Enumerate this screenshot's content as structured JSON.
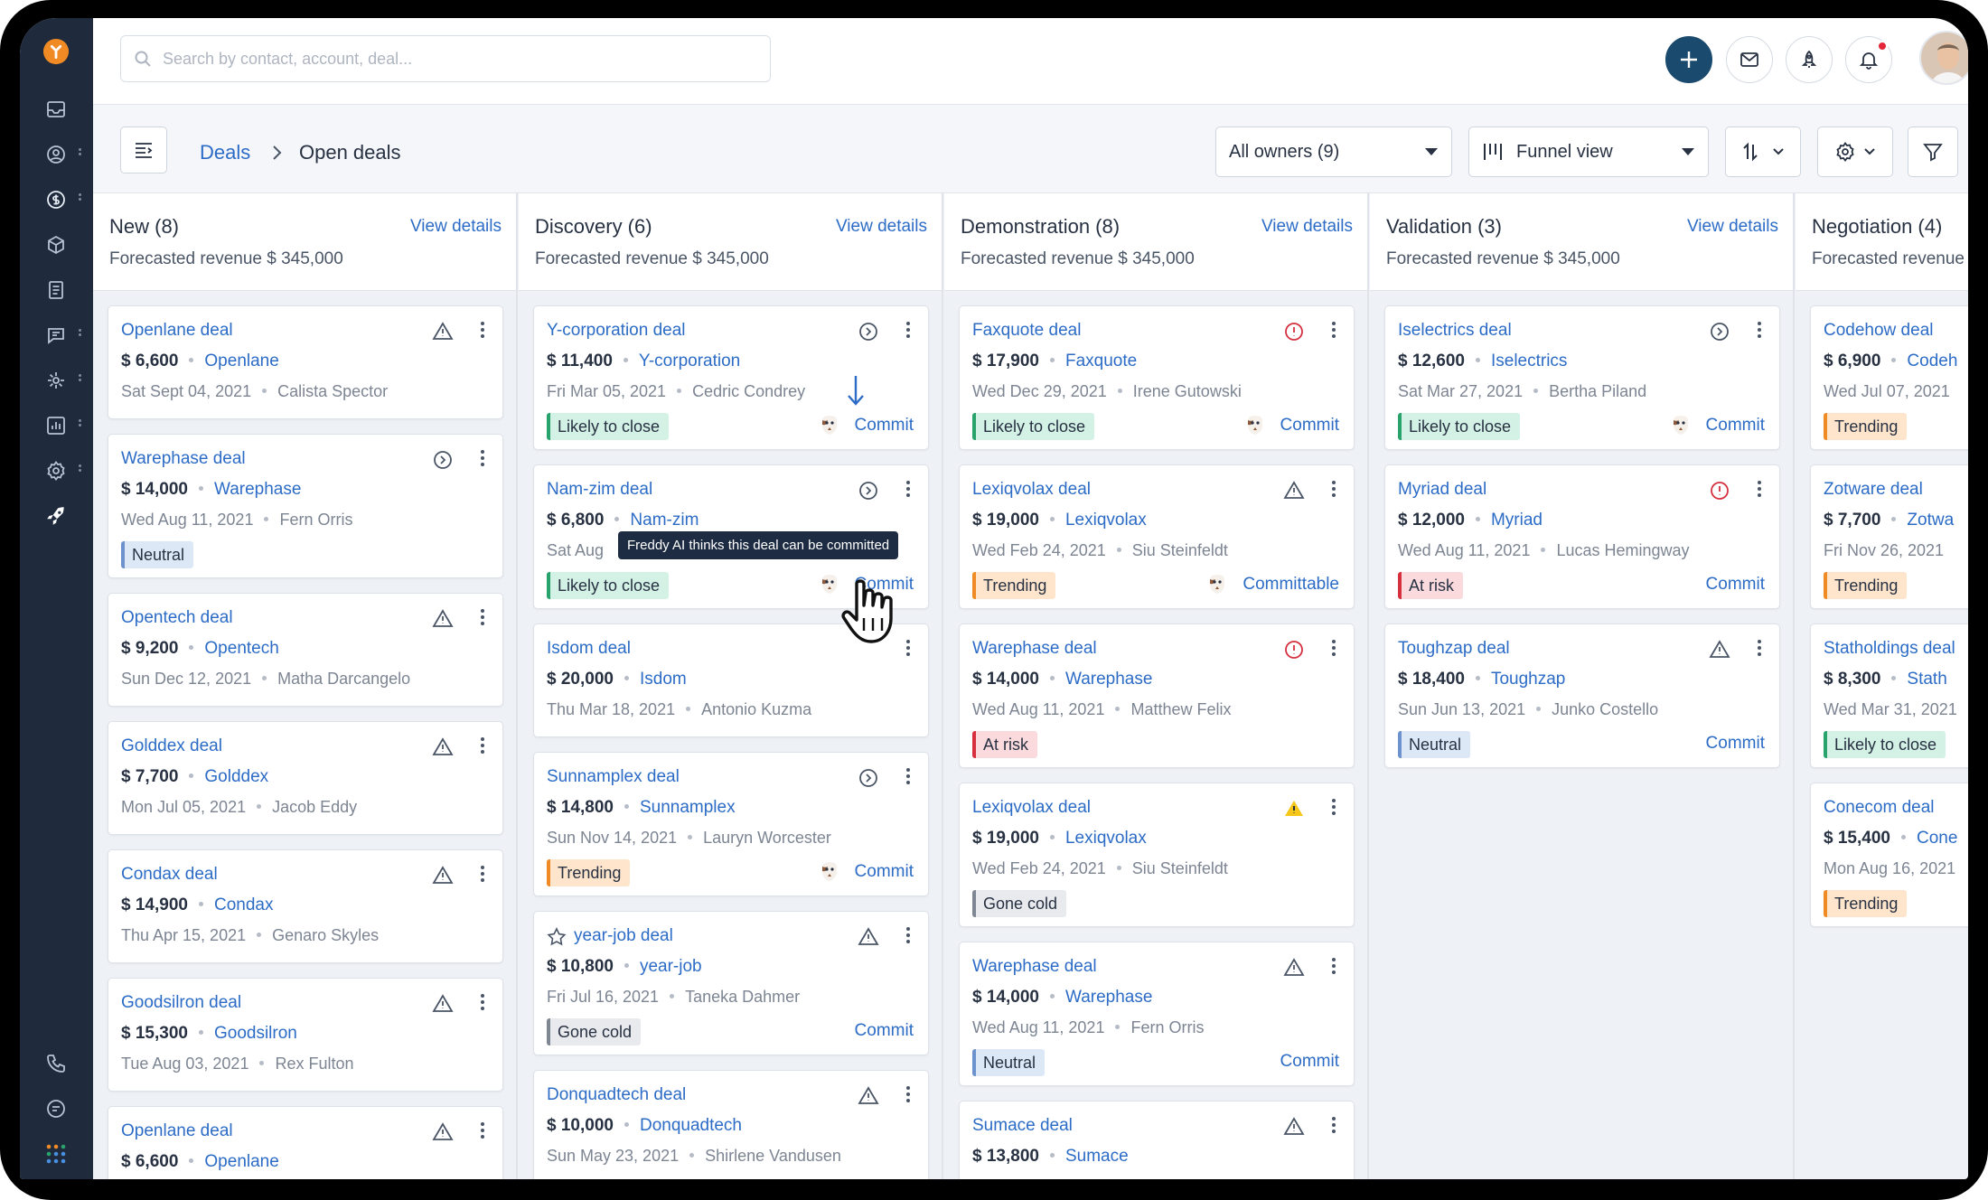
{
  "search": {
    "placeholder": "Search by contact, account, deal..."
  },
  "breadcrumb": {
    "root": "Deals",
    "current": "Open deals"
  },
  "toolbar": {
    "owners": "All owners (9)",
    "view": "Funnel view"
  },
  "tooltip": "Freddy AI thinks this deal can be committed",
  "colors": {
    "accent": "#2c6cc6",
    "sidebar": "#1f2b3d",
    "brand_orange": "#f08a24",
    "add_button": "#1a4a6e"
  },
  "columns": [
    {
      "title": "New (8)",
      "view": "View details",
      "revenue": "Forecasted revenue $ 345,000",
      "cards": [
        {
          "name": "Openlane deal",
          "value": "$ 6,600",
          "account": "Openlane",
          "date": "Sat Sept 04, 2021",
          "contact": "Calista Spector",
          "icon": "warning-outline"
        },
        {
          "name": "Warephase deal",
          "value": "$ 14,000",
          "account": "Warephase",
          "date": "Wed Aug 11, 2021",
          "contact": "Fern Orris",
          "icon": "forward-circle",
          "tag": "Neutral",
          "tag_color": "blue"
        },
        {
          "name": "Opentech deal",
          "value": "$ 9,200",
          "account": "Opentech",
          "date": "Sun Dec 12, 2021",
          "contact": "Matha Darcangelo",
          "icon": "warning-outline"
        },
        {
          "name": "Golddex deal",
          "value": "$ 7,700",
          "account": "Golddex",
          "date": "Mon Jul 05, 2021",
          "contact": "Jacob Eddy",
          "icon": "warning-outline"
        },
        {
          "name": "Condax deal",
          "value": "$ 14,900",
          "account": "Condax",
          "date": "Thu Apr 15, 2021",
          "contact": "Genaro Skyles",
          "icon": "warning-outline"
        },
        {
          "name": "Goodsilron deal",
          "value": "$ 15,300",
          "account": "Goodsilron",
          "date": "Tue Aug 03, 2021",
          "contact": "Rex Fulton",
          "icon": "warning-outline"
        },
        {
          "name": "Openlane deal",
          "value": "$ 6,600",
          "account": "Openlane",
          "date": "",
          "contact": "",
          "icon": "warning-outline"
        }
      ]
    },
    {
      "title": "Discovery (6)",
      "view": "View details",
      "revenue": "Forecasted revenue $ 345,000",
      "cards": [
        {
          "name": "Y-corporation deal",
          "value": "$ 11,400",
          "account": "Y-corporation",
          "date": "Fri Mar 05, 2021",
          "contact": "Cedric Condrey",
          "icon": "forward-circle",
          "tag": "Likely to close",
          "tag_color": "green",
          "commit": "Commit",
          "freddy": true
        },
        {
          "name": "Nam-zim deal",
          "value": "$ 6,800",
          "account": "Nam-zim",
          "date": "Sat Aug",
          "contact": "",
          "icon": "forward-circle",
          "tag": "Likely to close",
          "tag_color": "green",
          "commit": "Commit",
          "freddy": true
        },
        {
          "name": "Isdom deal",
          "value": "$ 20,000",
          "account": "Isdom",
          "date": "Thu Mar 18, 2021",
          "contact": "Antonio Kuzma",
          "icon": ""
        },
        {
          "name": "Sunnamplex deal",
          "value": "$ 14,800",
          "account": "Sunnamplex",
          "date": "Sun Nov 14, 2021",
          "contact": "Lauryn Worcester",
          "icon": "forward-circle",
          "tag": "Trending",
          "tag_color": "orange",
          "commit": "Commit",
          "freddy": true
        },
        {
          "name": "year-job deal",
          "value": "$ 10,800",
          "account": "year-job",
          "date": "Fri Jul 16, 2021",
          "contact": "Taneka Dahmer",
          "icon": "warning-outline",
          "tag": "Gone cold",
          "tag_color": "gray",
          "commit": "Commit",
          "star": true
        },
        {
          "name": "Donquadtech deal",
          "value": "$ 10,000",
          "account": "Donquadtech",
          "date": "Sun May 23, 2021",
          "contact": "Shirlene Vandusen",
          "icon": "warning-outline"
        }
      ]
    },
    {
      "title": "Demonstration (8)",
      "view": "View details",
      "revenue": "Forecasted revenue $ 345,000",
      "cards": [
        {
          "name": "Faxquote deal",
          "value": "$ 17,900",
          "account": "Faxquote",
          "date": "Wed Dec 29, 2021",
          "contact": "Irene Gutowski",
          "icon": "alert-red",
          "tag": "Likely to close",
          "tag_color": "green",
          "commit": "Commit",
          "freddy": true
        },
        {
          "name": "Lexiqvolax deal",
          "value": "$ 19,000",
          "account": "Lexiqvolax",
          "date": "Wed Feb 24, 2021",
          "contact": "Siu Steinfeldt",
          "icon": "warning-outline",
          "tag": "Trending",
          "tag_color": "orange",
          "commit": "Committable",
          "freddy": true
        },
        {
          "name": "Warephase deal",
          "value": "$ 14,000",
          "account": "Warephase",
          "date": "Wed Aug 11, 2021",
          "contact": "Matthew Felix",
          "icon": "alert-red",
          "tag": "At risk",
          "tag_color": "red"
        },
        {
          "name": "Lexiqvolax deal",
          "value": "$ 19,000",
          "account": "Lexiqvolax",
          "date": "Wed Feb 24, 2021",
          "contact": "Siu Steinfeldt",
          "icon": "warning-yellow",
          "tag": "Gone cold",
          "tag_color": "gray"
        },
        {
          "name": "Warephase deal",
          "value": "$ 14,000",
          "account": "Warephase",
          "date": "Wed Aug 11, 2021",
          "contact": "Fern Orris",
          "icon": "warning-outline",
          "tag": "Neutral",
          "tag_color": "blue",
          "commit": "Commit"
        },
        {
          "name": "Sumace deal",
          "value": "$ 13,800",
          "account": "Sumace",
          "date": "",
          "contact": "",
          "icon": "warning-outline"
        }
      ]
    },
    {
      "title": "Validation (3)",
      "view": "View details",
      "revenue": "Forecasted revenue $ 345,000",
      "cards": [
        {
          "name": "Iselectrics deal",
          "value": "$ 12,600",
          "account": "Iselectrics",
          "date": "Sat Mar 27, 2021",
          "contact": "Bertha Piland",
          "icon": "forward-circle",
          "tag": "Likely to close",
          "tag_color": "green",
          "commit": "Commit",
          "freddy": true
        },
        {
          "name": "Myriad deal",
          "value": "$ 12,000",
          "account": "Myriad",
          "date": "Wed Aug 11, 2021",
          "contact": "Lucas Hemingway",
          "icon": "alert-red",
          "tag": "At risk",
          "tag_color": "red",
          "commit": "Commit"
        },
        {
          "name": "Toughzap deal",
          "value": "$ 18,400",
          "account": "Toughzap",
          "date": "Sun Jun 13, 2021",
          "contact": "Junko Costello",
          "icon": "warning-outline",
          "tag": "Neutral",
          "tag_color": "blue",
          "commit": "Commit"
        }
      ]
    },
    {
      "title": "Negotiation (4)",
      "view": "",
      "revenue": "Forecasted revenue",
      "cards": [
        {
          "name": "Codehow deal",
          "value": "$ 6,900",
          "account": "Codeh",
          "date": "Wed Jul 07, 2021",
          "contact": "",
          "icon": "",
          "tag": "Trending",
          "tag_color": "orange"
        },
        {
          "name": "Zotware deal",
          "value": "$ 7,700",
          "account": "Zotwa",
          "date": "Fri Nov 26, 2021",
          "contact": "",
          "icon": "",
          "tag": "Trending",
          "tag_color": "orange"
        },
        {
          "name": "Statholdings deal",
          "value": "$ 8,300",
          "account": "Stath",
          "date": "Wed Mar 31, 2021",
          "contact": "",
          "icon": "",
          "tag": "Likely to close",
          "tag_color": "green"
        },
        {
          "name": "Conecom deal",
          "value": "$ 15,400",
          "account": "Cone",
          "date": "Mon Aug 16, 2021",
          "contact": "",
          "icon": "",
          "tag": "Trending",
          "tag_color": "orange"
        }
      ]
    }
  ]
}
